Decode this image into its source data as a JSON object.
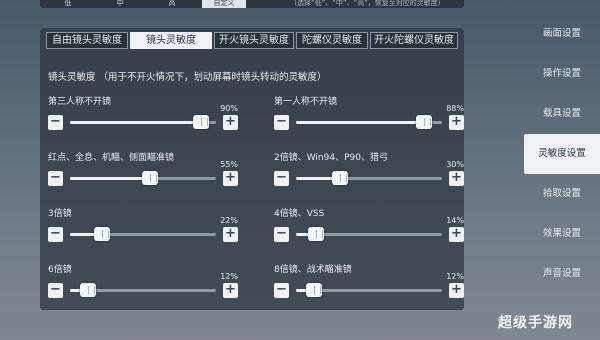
{
  "top_presets": {
    "buttons": [
      "低",
      "中",
      "高",
      "自定义"
    ],
    "active_index": 3,
    "note": "（选择“低”、“中”、“高”，恢复至对应的灵敏度）"
  },
  "tabs": [
    {
      "label": "自由镜头灵敏度",
      "active": false
    },
    {
      "label": "镜头灵敏度",
      "active": true
    },
    {
      "label": "开火镜头灵敏度",
      "active": false
    },
    {
      "label": "陀螺仪灵敏度",
      "active": false
    },
    {
      "label": "开火陀螺仪灵敏度",
      "active": false
    }
  ],
  "section_title": "镜头灵敏度 （用于不开火情况下，划动屏幕时镜头转动的灵敏度）",
  "sliders": [
    {
      "label": "第三人称不开镜",
      "value_text": "90%",
      "level": 0.9,
      "minus": "−",
      "plus": "+"
    },
    {
      "label": "第一人称不开镜",
      "value_text": "88%",
      "level": 0.88,
      "minus": "−",
      "plus": "+"
    },
    {
      "label": "红点、全息、机瞄、侧面瞄准镜",
      "value_text": "55%",
      "level": 0.55,
      "minus": "−",
      "plus": "+"
    },
    {
      "label": "2倍镜、Win94、P90、猎弓",
      "value_text": "30%",
      "level": 0.3,
      "minus": "−",
      "plus": "+"
    },
    {
      "label": "3倍镜",
      "value_text": "22%",
      "level": 0.22,
      "minus": "−",
      "plus": "+"
    },
    {
      "label": "4倍镜、VSS",
      "value_text": "14%",
      "level": 0.14,
      "minus": "−",
      "plus": "+"
    },
    {
      "label": "6倍镜",
      "value_text": "12%",
      "level": 0.12,
      "minus": "−",
      "plus": "+"
    },
    {
      "label": "8倍镜、战术瞄准镜",
      "value_text": "12%",
      "level": 0.12,
      "minus": "−",
      "plus": "+"
    }
  ],
  "sidebar": [
    {
      "label": "画面设置",
      "active": false
    },
    {
      "label": "操作设置",
      "active": false
    },
    {
      "label": "载具设置",
      "active": false
    },
    {
      "label": "灵敏度设置",
      "active": true
    },
    {
      "label": "拾取设置",
      "active": false
    },
    {
      "label": "效果设置",
      "active": false
    },
    {
      "label": "声音设置",
      "active": false
    }
  ],
  "watermark": "超级手游网"
}
